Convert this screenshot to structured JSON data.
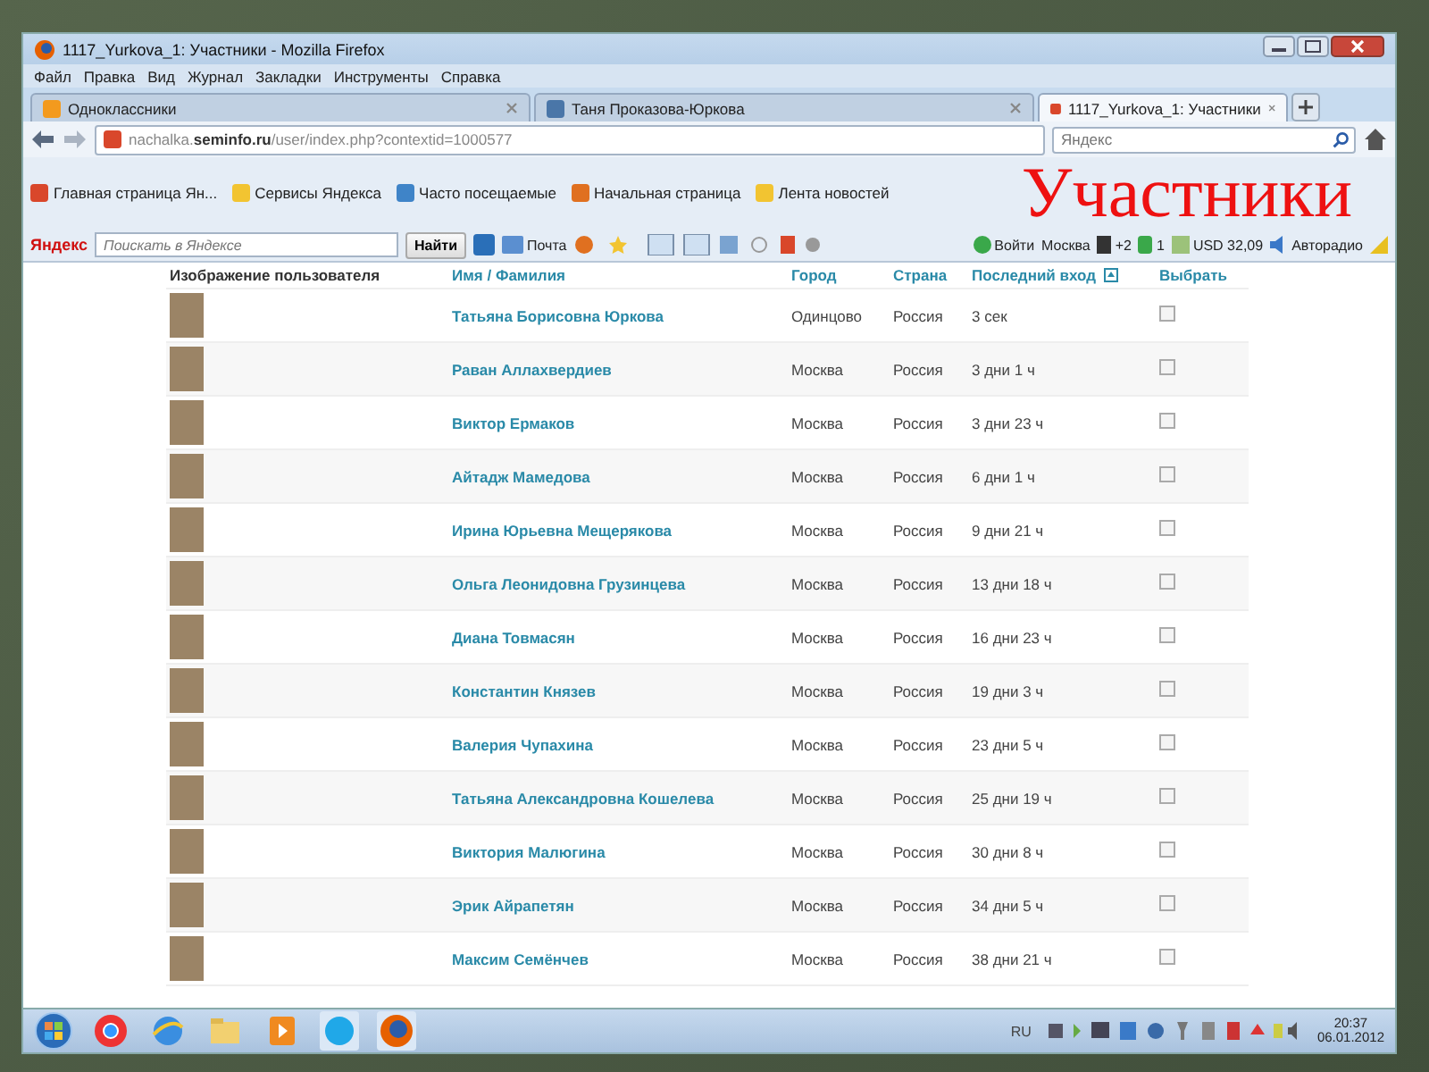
{
  "slide_title": "Участники",
  "window": {
    "title": "1117_Yurkova_1: Участники - Mozilla Firefox"
  },
  "menu": [
    "Файл",
    "Правка",
    "Вид",
    "Журнал",
    "Закладки",
    "Инструменты",
    "Справка"
  ],
  "tabs": [
    {
      "label": "Одноклассники",
      "selected": false
    },
    {
      "label": "Таня Проказова-Юркова",
      "selected": false
    },
    {
      "label": "1117_Yurkova_1: Участники",
      "selected": true
    }
  ],
  "address": "nachalka.**seminfo.ru**/user/index.php?contextid=1000577",
  "search": {
    "placeholder": "Яндекс"
  },
  "bookmarks": [
    "Главная страница Ян...",
    "Сервисы Яндекса",
    "Часто посещаемые",
    "Начальная страница",
    "Лента новостей"
  ],
  "yandex_bar": {
    "logo": "Яндекс",
    "placeholder": "Поискать в Яндексе",
    "button": "Найти",
    "mail": "Почта",
    "login": "Войти",
    "city": "Москва",
    "messages": "+2",
    "counter": "1",
    "currency": "USD 32,09",
    "radio": "Авторадио"
  },
  "table": {
    "columns": [
      "Изображение пользователя",
      "Имя / Фамилия",
      "Город",
      "Страна",
      "Последний вход",
      "Выбрать"
    ],
    "rows": [
      {
        "name": "Татьяна Борисовна Юркова",
        "city": "Одинцово",
        "country": "Россия",
        "last": "3 сек",
        "checked": false
      },
      {
        "name": "Раван Аллахвердиев",
        "city": "Москва",
        "country": "Россия",
        "last": "3 дни 1 ч",
        "checked": false
      },
      {
        "name": "Виктор Ермаков",
        "city": "Москва",
        "country": "Россия",
        "last": "3 дни 23 ч",
        "checked": false
      },
      {
        "name": "Айтадж Мамедова",
        "city": "Москва",
        "country": "Россия",
        "last": "6 дни 1 ч",
        "checked": false
      },
      {
        "name": "Ирина Юрьевна Мещерякова",
        "city": "Москва",
        "country": "Россия",
        "last": "9 дни 21 ч",
        "checked": false
      },
      {
        "name": "Ольга Леонидовна Грузинцева",
        "city": "Москва",
        "country": "Россия",
        "last": "13 дни 18 ч",
        "checked": false
      },
      {
        "name": "Диана Товмасян",
        "city": "Москва",
        "country": "Россия",
        "last": "16 дни 23 ч",
        "checked": false
      },
      {
        "name": "Константин Князев",
        "city": "Москва",
        "country": "Россия",
        "last": "19 дни 3 ч",
        "checked": false
      },
      {
        "name": "Валерия Чупахина",
        "city": "Москва",
        "country": "Россия",
        "last": "23 дни 5 ч",
        "checked": false
      },
      {
        "name": "Татьяна Александровна Кошелева",
        "city": "Москва",
        "country": "Россия",
        "last": "25 дни 19 ч",
        "checked": false
      },
      {
        "name": "Виктория Малюгина",
        "city": "Москва",
        "country": "Россия",
        "last": "30 дни 8 ч",
        "checked": false
      },
      {
        "name": "Эрик Айрапетян",
        "city": "Москва",
        "country": "Россия",
        "last": "34 дни 5 ч",
        "checked": false
      },
      {
        "name": "Максим Семёнчев",
        "city": "Москва",
        "country": "Россия",
        "last": "38 дни 21 ч",
        "checked": false
      }
    ]
  },
  "taskbar": {
    "language": "RU",
    "time": "20:37",
    "date": "06.01.2012"
  }
}
